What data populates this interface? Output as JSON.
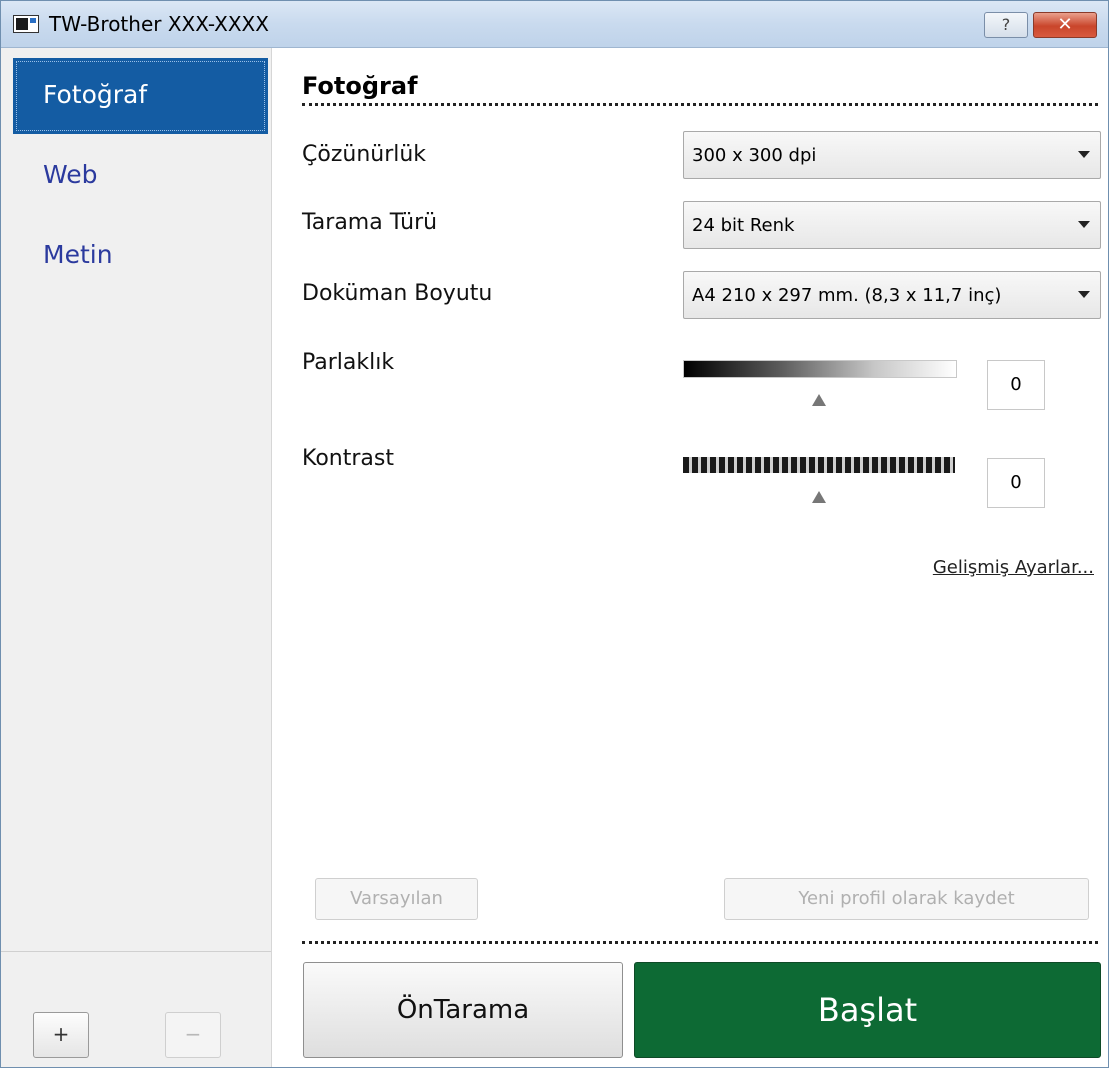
{
  "window": {
    "title": "TW-Brother XXX-XXXX",
    "help_label": "?",
    "close_label": "✕"
  },
  "sidebar": {
    "items": [
      {
        "label": "Fotoğraf",
        "active": true
      },
      {
        "label": "Web",
        "active": false
      },
      {
        "label": "Metin",
        "active": false
      }
    ],
    "add_label": "+",
    "remove_label": "−"
  },
  "main": {
    "heading": "Fotoğraf",
    "resolution": {
      "label": "Çözünürlük",
      "value": "300 x 300 dpi"
    },
    "scan_type": {
      "label": "Tarama Türü",
      "value": "24 bit Renk"
    },
    "document_size": {
      "label": "Doküman Boyutu",
      "value": "A4 210 x 297 mm. (8,3 x 11,7 inç)"
    },
    "brightness": {
      "label": "Parlaklık",
      "value": "0",
      "level": 0.5
    },
    "contrast": {
      "label": "Kontrast",
      "value": "0",
      "level": 0.5
    },
    "advanced_link": "Gelişmiş Ayarlar...",
    "default_button": "Varsayılan",
    "save_profile_button": "Yeni profil olarak kaydet",
    "prescan_button": "ÖnTarama",
    "start_button": "Başlat"
  },
  "colors": {
    "accent": "#145ca3",
    "start_green": "#0d6a34",
    "sidebar_text": "#2b3a9e"
  },
  "icons": {
    "app": "scanner-window-icon",
    "help": "help-icon",
    "close": "close-icon",
    "dropdown": "chevron-down-icon"
  }
}
